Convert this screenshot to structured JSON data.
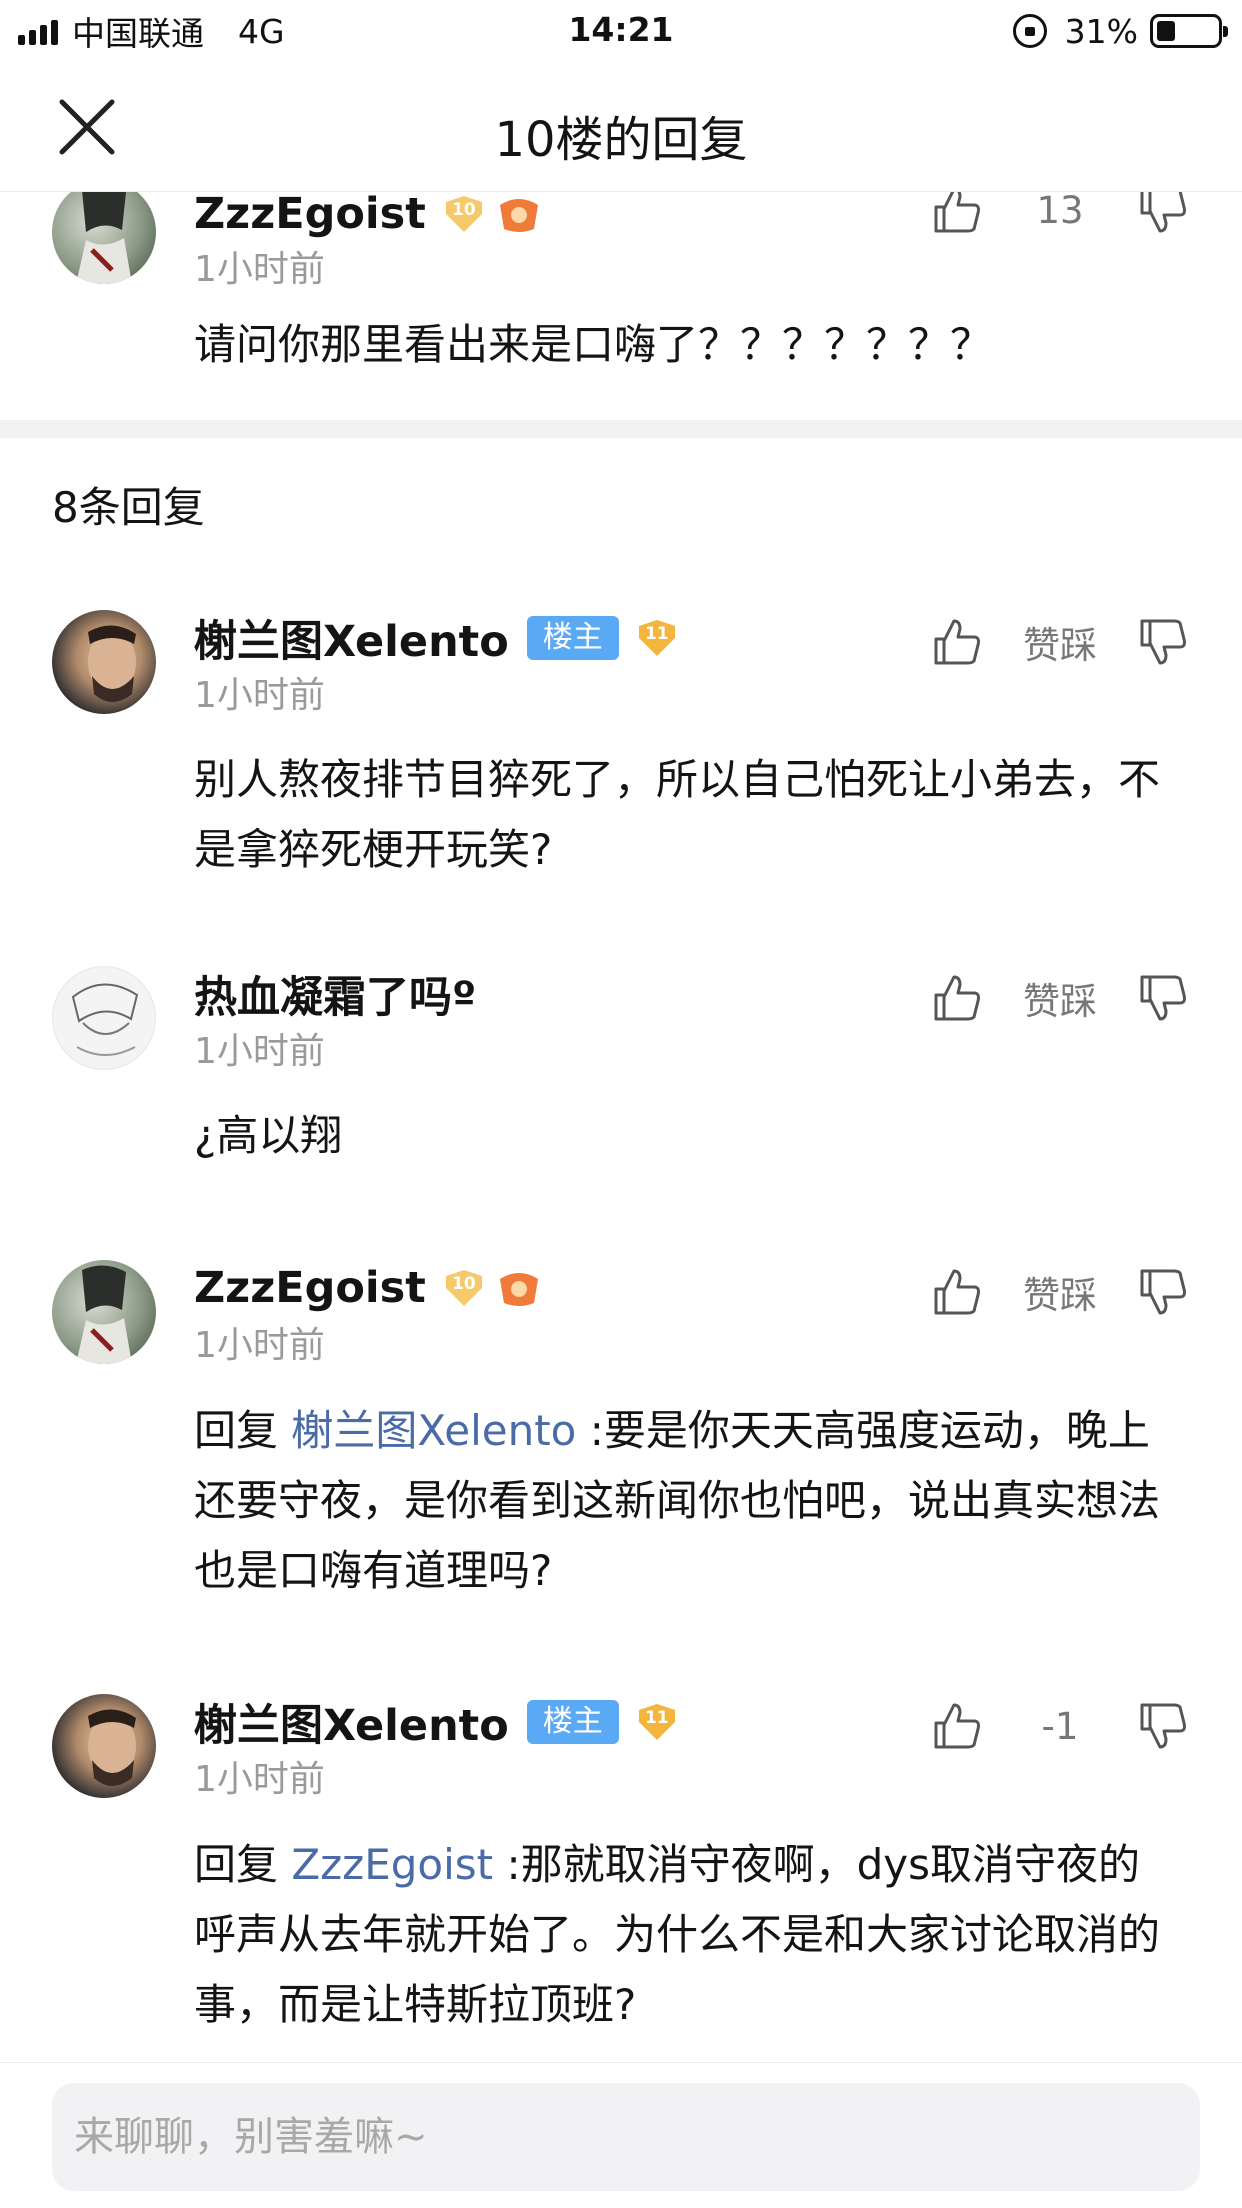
{
  "status_bar": {
    "carrier": "中国联通",
    "network": "4G",
    "time": "14:21",
    "battery": "31%",
    "battery_level": 0.31
  },
  "header": {
    "title": "10楼的回复",
    "close_icon": "close-icon"
  },
  "main_comment": {
    "username": "ZzzEgoist",
    "level": "10",
    "time": "1小时前",
    "text": "请问你那里看出来是口嗨了？？？？？？？",
    "votes": "13"
  },
  "replies_count": "8条回复",
  "replies": [
    {
      "username": "榭兰图Xelento",
      "owner_badge": "楼主",
      "level": "11",
      "time": "1小时前",
      "text": "别人熬夜排节目猝死了，所以自己怕死让小弟去，不是拿猝死梗开玩笑?",
      "votes": "赞踩"
    },
    {
      "username": "热血凝霜了吗º",
      "time": "1小时前",
      "text": "¿高以翔",
      "votes": "赞踩"
    },
    {
      "username": "ZzzEgoist",
      "level": "10",
      "time": "1小时前",
      "reply_prefix": "回复 ",
      "reply_to": "榭兰图Xelento",
      "text": " :要是你天天高强度运动，晚上还要守夜，是你看到这新闻你也怕吧，说出真实想法也是口嗨有道理吗?",
      "votes": "赞踩"
    },
    {
      "username": "榭兰图Xelento",
      "owner_badge": "楼主",
      "level": "11",
      "time": "1小时前",
      "reply_prefix": "回复 ",
      "reply_to": "ZzzEgoist",
      "text": " :那就取消守夜啊，dys取消守夜的呼声从去年就开始了。为什么不是和大家讨论取消的事，而是让特斯拉顶班?",
      "votes": "-1"
    }
  ],
  "footer": {
    "input_placeholder": "来聊聊，别害羞嘛~"
  },
  "colors": {
    "owner_badge": "#5aa9f4",
    "level_badge": "#f3b53c",
    "mention": "#4a6aa8",
    "divider": "#f2f2f4"
  }
}
